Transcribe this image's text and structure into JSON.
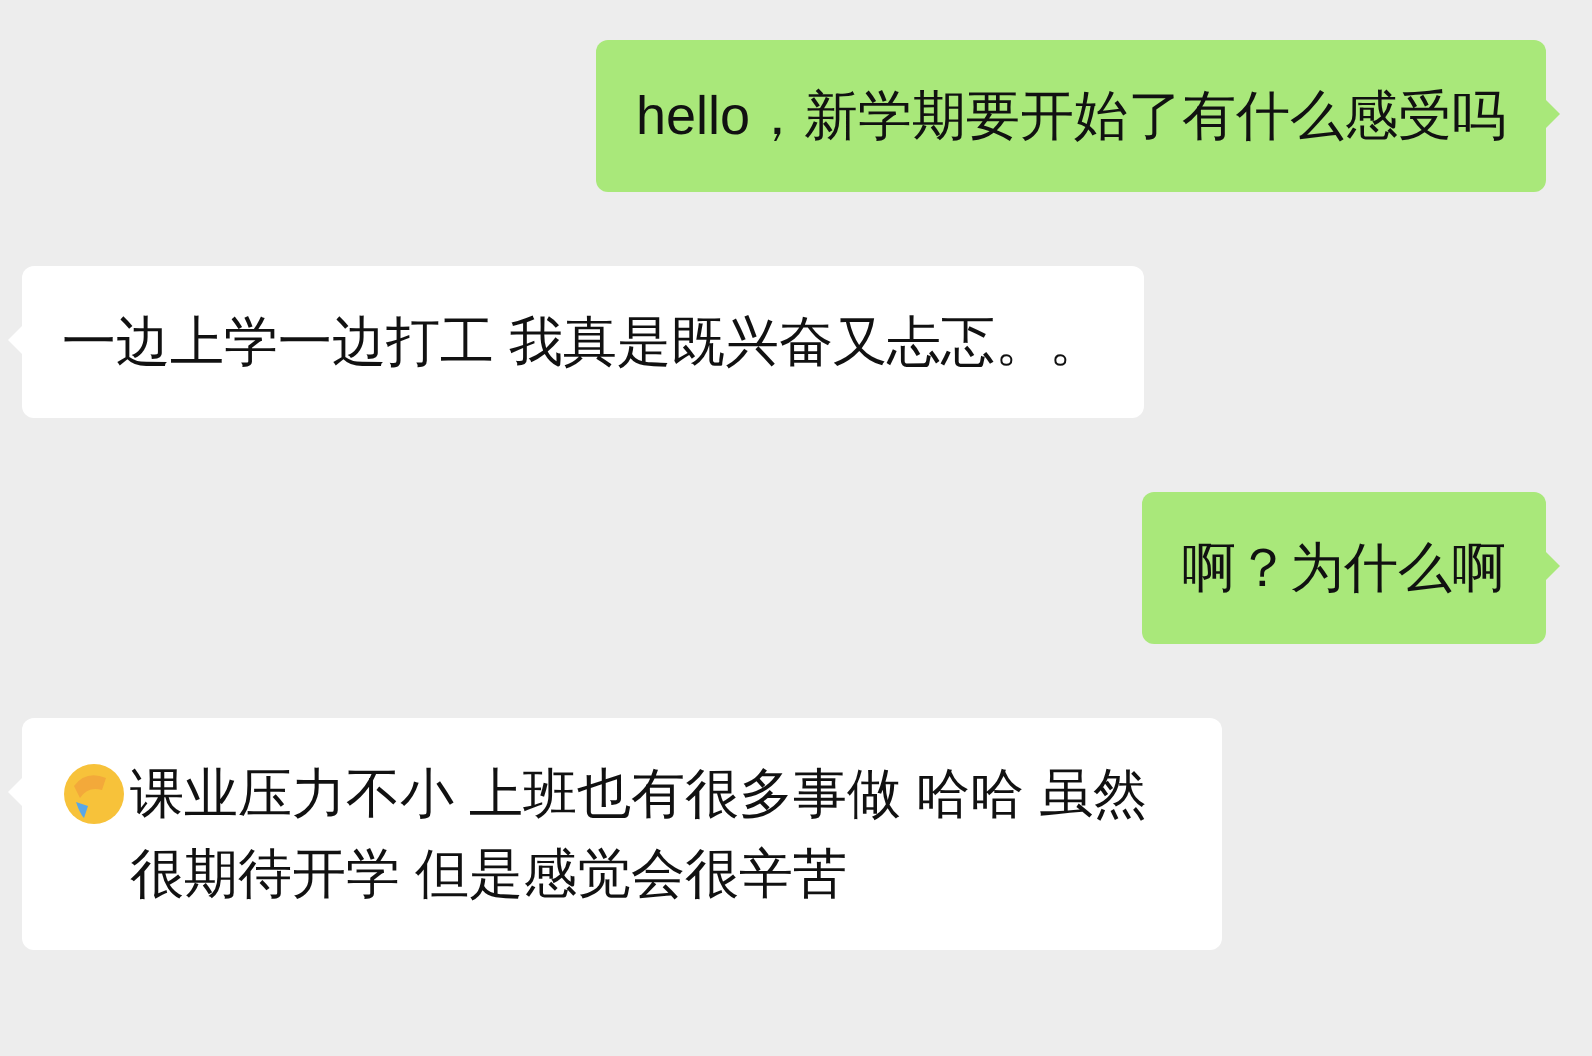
{
  "messages": [
    {
      "kind": "outgoing",
      "emoji": false,
      "text": "hello，新学期要开始了有什么感受吗"
    },
    {
      "kind": "incoming",
      "emoji": false,
      "text": "一边上学一边打工 我真是既兴奋又忐忑。。"
    },
    {
      "kind": "outgoing",
      "emoji": false,
      "text": "啊？为什么啊"
    },
    {
      "kind": "incoming",
      "emoji": true,
      "text": "课业压力不小 上班也有很多事做 哈哈 虽然很期待开学 但是感觉会很辛苦"
    }
  ]
}
